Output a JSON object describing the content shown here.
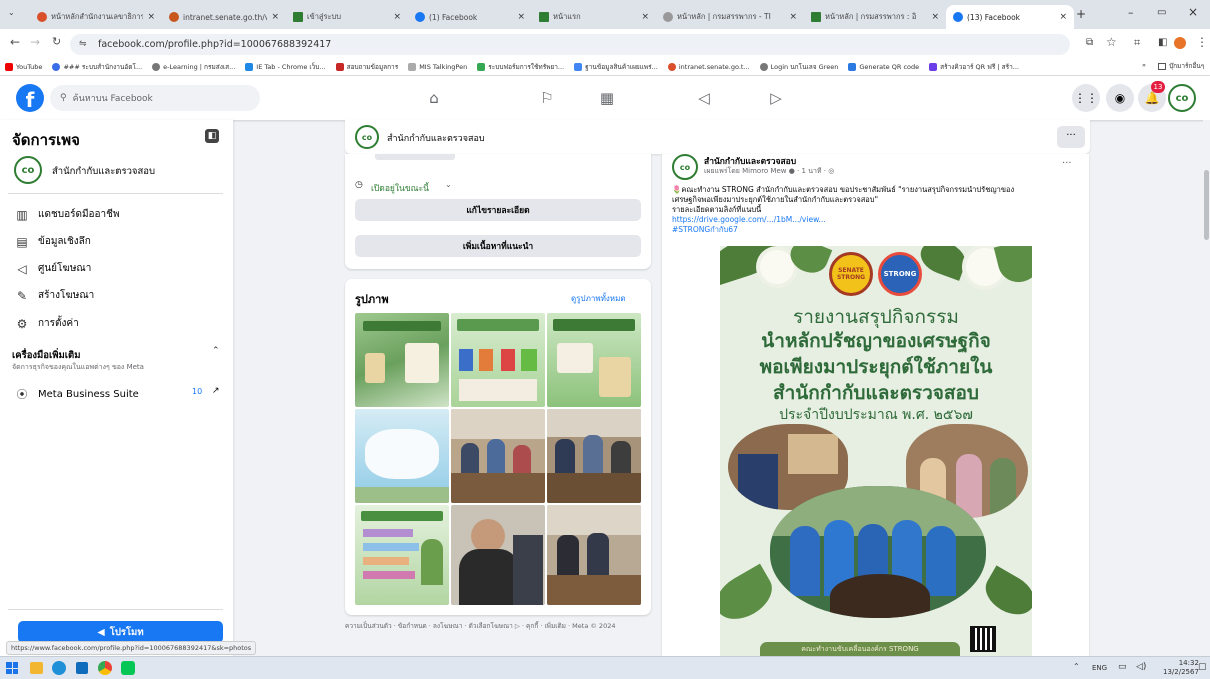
{
  "browser": {
    "tabs": [
      {
        "label": "หน้าหลักสำนักงานเลขาธิการ",
        "color": "#d9502b"
      },
      {
        "label": "intranet.senate.go.th/view",
        "color": "#c8571e"
      },
      {
        "label": "เข้าสู่ระบบ",
        "color": "#2e7d32"
      },
      {
        "label": "(1) Facebook",
        "color": "#1877f2"
      },
      {
        "label": "หน้าแรก",
        "color": "#2e7d32"
      },
      {
        "label": "หน้าหลัก | กรมสรรพากร - TI",
        "color": "#999999"
      },
      {
        "label": "หน้าหลัก | กรมสรรพากร : อิ",
        "color": "#2e7d32"
      },
      {
        "label": "(13) Facebook",
        "color": "#1877f2"
      }
    ],
    "url": "facebook.com/profile.php?id=100067688392417",
    "bookmarks": [
      "YouTube",
      "### ระบบสำนักงานอัตโ...",
      "e-Learning | กรมส่งเส...",
      "IE Tab - Chrome เว็บ...",
      "สอบถามข้อมูลการ",
      "MIS TalkingPen",
      "ระบบฟอร์มการใช้ทรัพยา...",
      "ฐานข้อมูลสินค้าเผยแพร่...",
      "intranet.senate.go.t...",
      "Login นกโนเลจ Green",
      "Generate QR code",
      "สร้างคิวอาร์ QR ฟรี | สร้า...",
      "บุ๊กมาร์กอื่นๆ"
    ],
    "status_url": "https://www.facebook.com/profile.php?id=100067688392417&sk=photos"
  },
  "header": {
    "search_placeholder": "ค้นหาบน Facebook",
    "notif_count": "13"
  },
  "sidebar": {
    "title": "จัดการเพจ",
    "page_name": "สำนักกำกับและตรวจสอบ",
    "items": [
      "แดชบอร์ดมืออาชีพ",
      "ข้อมูลเชิงลึก",
      "ศูนย์โฆษณา",
      "สร้างโฆษณา",
      "การตั้งค่า"
    ],
    "tools_title": "เครื่องมือเพิ่มเติม",
    "tools_sub": "จัดการธุรกิจของคุณในแอพต่างๆ ของ Meta",
    "mbs_label": "Meta Business Suite",
    "mbs_count": "10",
    "promote": "โปรโมท"
  },
  "page_bar": {
    "name": "สำนักกำกับและตรวจสอบ"
  },
  "left_card": {
    "open_status": "เปิดอยู่ในขณะนี้",
    "edit_btn": "แก้ไขรายละเอียด",
    "add_btn": "เพิ่มเนื้อหาที่แนะนำ"
  },
  "photos": {
    "title": "รูปภาพ",
    "see_all": "ดูรูปภาพทั้งหมด"
  },
  "footer": "ความเป็นส่วนตัว · ข้อกำหนด · ลงโฆษณา · ตัวเลือกโฆษณา ▷ · คุกกี้ · เพิ่มเติม · Meta © 2024",
  "post": {
    "author": "สำนักกำกับและตรวจสอบ",
    "meta": "เผยแพร่โดย Mimoro Mew ● · 1 นาที · ◎",
    "text1": "🌷คณะทำงาน STRONG สำนักกำกับและตรวจสอบ ขอประชาสัมพันธ์ \"รายงานสรุปกิจกรรมนำปรัชญาของ",
    "text2": "เศรษฐกิจพอเพียงมาประยุกต์ใช้ภายในสำนักกำกับและตรวจสอบ\"",
    "text3": "รายละเอียดตามลิงก์ที่แนบนี้",
    "link": "https://drive.google.com/.../1bM.../view...",
    "hashtag": "#STRONGกำกับ67",
    "img_line1": "รายงานสรุปกิจกรรม",
    "img_line2": "นำหลักปรัชญาของเศรษฐกิจ",
    "img_line3": "พอเพียงมาประยุกต์ใช้ภายใน",
    "img_line4": "สำนักกำกับและตรวจสอบ",
    "img_line5": "ประจำปีงบประมาณ พ.ศ. ๒๕๖๗",
    "img_footer": "คณะทำงานขับเคลื่อนองค์กร STRONG",
    "badge1": "SENATE STRONG",
    "badge2": "STRONG"
  },
  "taskbar": {
    "lang": "ENG",
    "time": "14:32",
    "date": "13/2/2567"
  }
}
